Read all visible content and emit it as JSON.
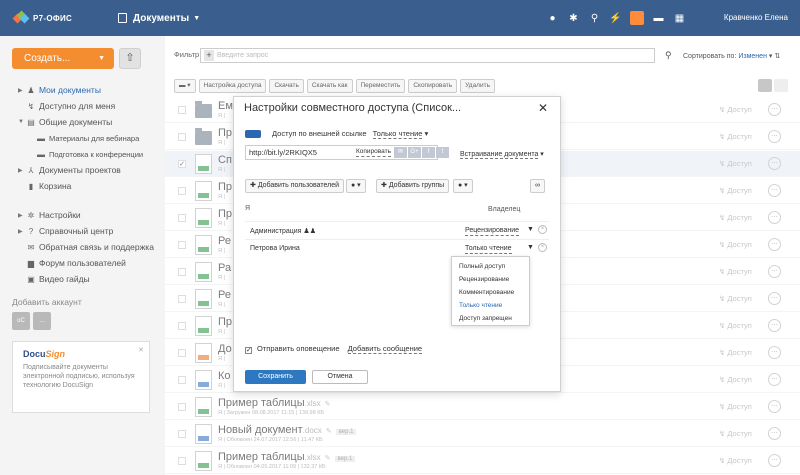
{
  "topbar": {
    "logo": "Р7-ОФИС",
    "module": "Документы",
    "user": "Кравченко Елена"
  },
  "sidebar": {
    "create": "Создать...",
    "upload_icon": "upload-icon",
    "items": [
      {
        "label": "Мои документы",
        "active": true
      },
      {
        "label": "Доступно для меня"
      },
      {
        "label": "Общие документы"
      },
      {
        "label": "Материалы для вебинара"
      },
      {
        "label": "Подготовка к конференции"
      },
      {
        "label": "Документы проектов"
      },
      {
        "label": "Корзина"
      },
      {
        "label": "Настройки"
      },
      {
        "label": "Справочный центр"
      },
      {
        "label": "Обратная связь и поддержка"
      },
      {
        "label": "Форум пользователей"
      },
      {
        "label": "Видео гайды"
      }
    ],
    "add_account": "Добавить аккаунт",
    "promo": {
      "brand_a": "Docu",
      "brand_b": "Sign",
      "text": "Подписывайте документы электронной подписью, используя технологию DocuSign"
    }
  },
  "toolbar": {
    "filter_label": "Фильтр",
    "search_placeholder": "Введите запрос",
    "sort_label": "Сортировать по:",
    "sort_value": "Изменен",
    "actions": [
      "Настройка доступа",
      "Скачать",
      "Скачать как",
      "Переместить",
      "Скопировать",
      "Удалить"
    ]
  },
  "files": [
    {
      "name": "Ем",
      "type": "folder",
      "meta": "Я |",
      "access": "Доступ"
    },
    {
      "name": "Пр",
      "type": "folder",
      "meta": "Я |",
      "access": "Доступ"
    },
    {
      "name": "Сп",
      "type": "xls",
      "meta": "Я |",
      "access": "Доступ",
      "selected": true
    },
    {
      "name": "Пр",
      "type": "xls",
      "meta": "Я |",
      "access": "Доступ"
    },
    {
      "name": "Пр",
      "type": "xls",
      "meta": "Я |",
      "access": "Доступ"
    },
    {
      "name": "Ре",
      "type": "xls",
      "meta": "Я |",
      "access": "Доступ"
    },
    {
      "name": "Ра",
      "type": "xls",
      "meta": "Я |",
      "access": "Доступ"
    },
    {
      "name": "Ре",
      "type": "xls",
      "meta": "Я |",
      "access": "Доступ"
    },
    {
      "name": "Пр",
      "type": "xls",
      "meta": "Я |",
      "access": "Доступ"
    },
    {
      "name": "До",
      "type": "ppt",
      "meta": "Я |",
      "access": "Доступ"
    },
    {
      "name": "Ко",
      "type": "doc",
      "meta": "Я |",
      "access": "Доступ"
    },
    {
      "name": "Пример таблицы",
      "ext": ".xlsx",
      "type": "xls",
      "meta": "Я | Загружен 08.08.2017 11:15 | 139.98 КБ",
      "access": "Доступ"
    },
    {
      "name": "Новый документ",
      "ext": ".docx",
      "ver": "вер.1",
      "type": "doc",
      "meta": "Я | Обновлен 24.07.2017 12:56 | 11.47 КБ",
      "access": "Доступ"
    },
    {
      "name": "Пример таблицы",
      "ext": ".xlsx",
      "ver": "вер.1",
      "type": "xls",
      "meta": "Я | Обновлен 04.05.2017 11:09 | 132.37 КБ",
      "access": "Доступ"
    }
  ],
  "modal": {
    "title": "Настройки совместного доступа (Список...",
    "ext_access_label": "Доступ по внешней ссылке",
    "ext_access_value": "Только чтение",
    "link": "http://bit.ly/2RKIQX5",
    "copy_link": "Копировать",
    "embed": "Встраивание документа",
    "add_users": "Добавить пользователей",
    "add_groups": "Добавить группы",
    "owner_name": "Я",
    "owner_role": "Владелец",
    "rows": [
      {
        "name": "Администрация",
        "role": "Рецензирование"
      },
      {
        "name": "Петрова Ирина",
        "role": "Только чтение"
      }
    ],
    "dropdown": [
      "Полный доступ",
      "Рецензирование",
      "Комментирование",
      "Только чтение",
      "Доступ запрещен"
    ],
    "dropdown_selected": "Только чтение",
    "notify": "Отправить оповещение",
    "add_message": "Добавить сообщение",
    "save": "Сохранить",
    "cancel": "Отмена"
  }
}
